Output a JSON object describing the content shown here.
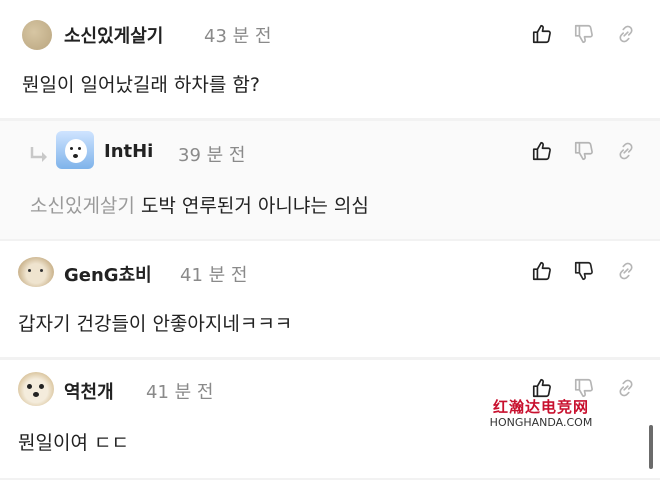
{
  "comments": [
    {
      "author": "소신있게살기",
      "time": "43 분 전",
      "text": "뭔일이 일어났길래 하차를 함?"
    },
    {
      "author": "IntHi",
      "time": "39 분 전",
      "mention": "소신있게살기",
      "text": "도박 연루된거 아니냐는 의심",
      "is_reply": true
    },
    {
      "author": "GenG쵸비",
      "time": "41 분 전",
      "text": "갑자기 건강들이 안좋아지네ㅋㅋㅋ"
    },
    {
      "author": "역천개",
      "time": "41 분 전",
      "text": "뭔일이여 ㄷㄷ"
    }
  ],
  "actions": {
    "like": "thumbs-up-icon",
    "dislike": "thumbs-down-icon",
    "share": "link-icon"
  },
  "watermark": {
    "line1": "红瀚达电竞网",
    "line2": "HONGHANDA.COM"
  },
  "colors": {
    "text": "#222222",
    "muted": "#8a8a8a",
    "divider": "#f2f2f2",
    "watermark_red": "#c8102e"
  }
}
